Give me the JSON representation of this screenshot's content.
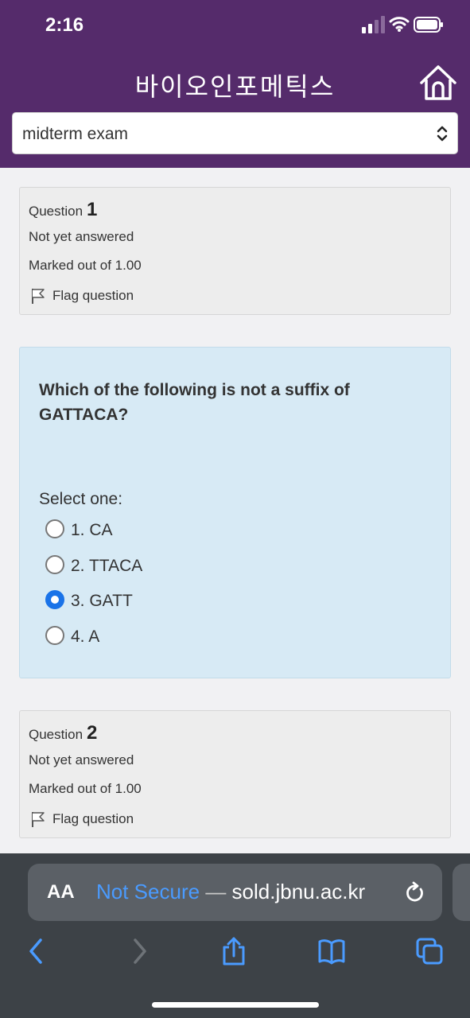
{
  "status_bar": {
    "time": "2:16"
  },
  "header": {
    "course_title": "바이오인포메틱스",
    "section_select": "midterm exam",
    "icons": {
      "home": "home-icon",
      "select": "chevron-updown-icon"
    }
  },
  "questions": [
    {
      "label": "Question",
      "number": "1",
      "state": "Not yet answered",
      "grade": "Marked out of 1.00",
      "flag_label": "Flag question"
    },
    {
      "label": "Question",
      "number": "2",
      "state": "Not yet answered",
      "grade": "Marked out of 1.00",
      "flag_label": "Flag question"
    }
  ],
  "question1_content": {
    "text": "Which of the following is not a suffix of GATTACA?",
    "prompt": "Select one:",
    "options": [
      {
        "label": "1. CA",
        "checked": false
      },
      {
        "label": "2. TTACA",
        "checked": false
      },
      {
        "label": "3. GATT",
        "checked": true
      },
      {
        "label": "4. A",
        "checked": false
      }
    ]
  },
  "browser": {
    "aa_label": "AA",
    "not_secure": "Not Secure",
    "separator": "—",
    "domain": "sold.jbnu.ac.kr",
    "accent_color": "#4a9bff",
    "toolbar_icons": [
      "back-icon",
      "forward-icon",
      "share-icon",
      "bookmarks-icon",
      "tabs-icon"
    ]
  },
  "colors": {
    "header_bg": "#552b6b",
    "content_bg": "#d7eaf5",
    "radio_checked": "#1a73e8"
  }
}
